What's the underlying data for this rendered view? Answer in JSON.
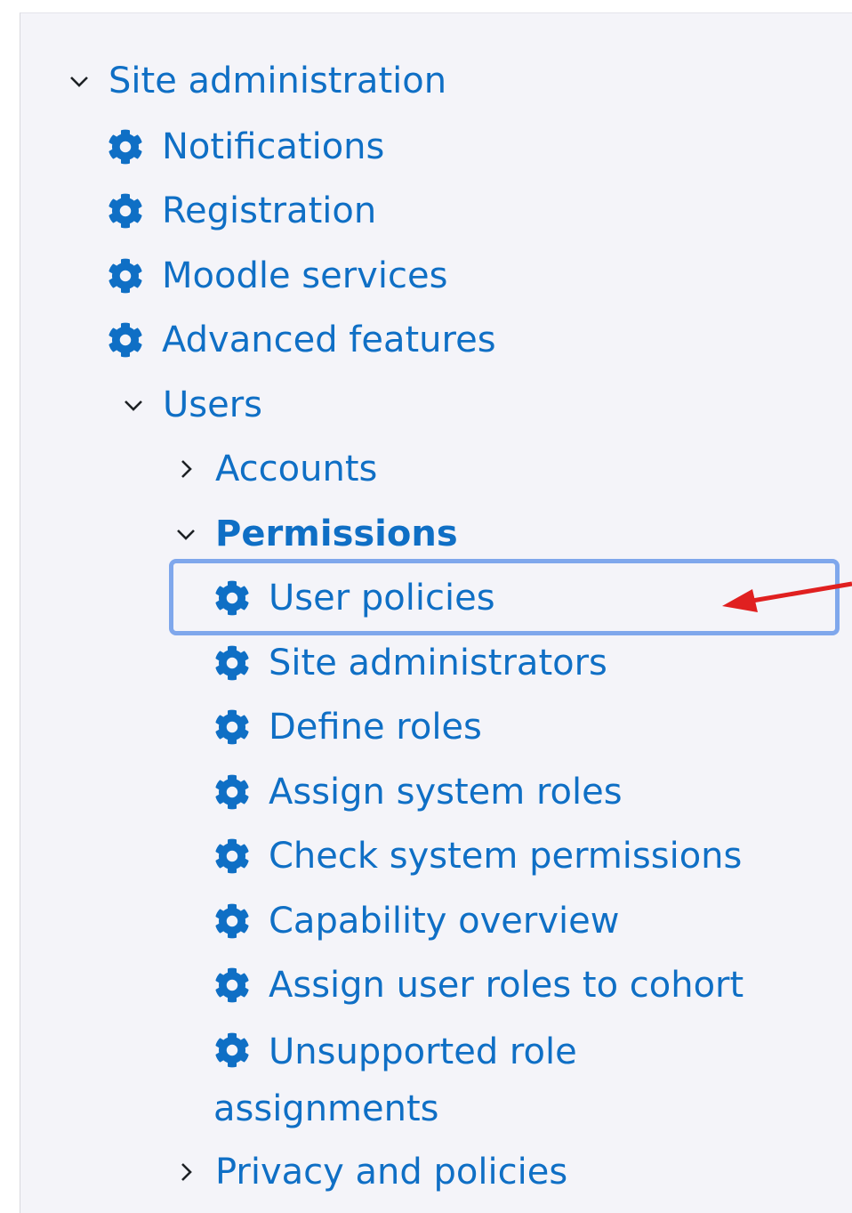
{
  "nav": {
    "site_admin": "Site administration",
    "notifications": "Notifications",
    "registration": "Registration",
    "moodle_services": "Moodle services",
    "advanced_features": "Advanced features",
    "users": "Users",
    "accounts": "Accounts",
    "permissions": "Permissions",
    "permission_items": [
      "User policies",
      "Site administrators",
      "Define roles",
      "Assign system roles",
      "Check system permissions",
      "Capability overview",
      "Assign user roles to cohort",
      "Unsupported role assignments"
    ],
    "privacy": "Privacy and policies"
  },
  "icons": {
    "expanded": "chevron-down-icon",
    "collapsed": "chevron-right-icon",
    "settings": "gear-icon"
  },
  "colors": {
    "link": "#0f6fc5",
    "chevron": "#1d2125",
    "panel_bg": "#f4f4f9",
    "highlight_border": "#7fa7ec",
    "annotation_arrow": "#e02020"
  }
}
